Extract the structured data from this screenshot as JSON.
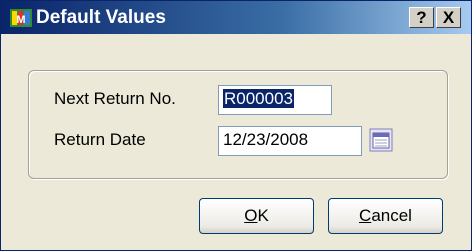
{
  "window": {
    "title": "Default Values",
    "help_label": "?",
    "close_label": "X"
  },
  "form": {
    "return_no_label": "Next Return No.",
    "return_no_value": "R000003",
    "return_date_label": "Return Date",
    "return_date_value": "12/23/2008"
  },
  "buttons": {
    "ok_accel": "O",
    "ok_rest": "K",
    "cancel_accel": "C",
    "cancel_rest": "ancel"
  },
  "icons": {
    "app": "sage-mas-app-icon",
    "calendar": "calendar-icon"
  }
}
